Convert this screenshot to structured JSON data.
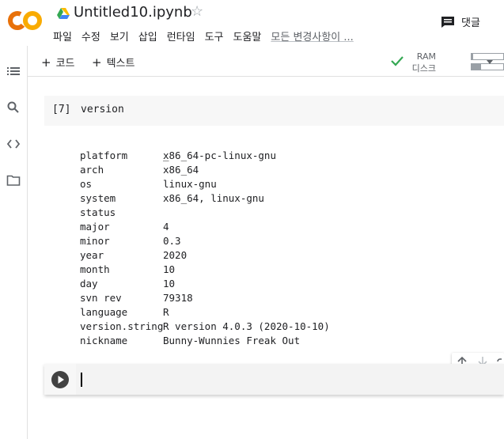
{
  "header": {
    "logo_text": "CO",
    "title": "Untitled10.ipynb",
    "menu": [
      "파일",
      "수정",
      "보기",
      "삽입",
      "런타임",
      "도구",
      "도움말"
    ],
    "changes_label": "모든 변경사항이 ...",
    "comment_label": "댓글"
  },
  "toolbar": {
    "add_code_label": "코드",
    "add_text_label": "텍스트",
    "ram_label": "RAM",
    "disk_label": "디스크",
    "ram_usage": 0.05,
    "disk_usage": 0.3
  },
  "cell": {
    "exec_count": "[7]",
    "code": "version"
  },
  "output": {
    "dash": "_",
    "rows": [
      {
        "key": "platform",
        "value": "x86_64-pc-linux-gnu"
      },
      {
        "key": "arch",
        "value": "x86_64"
      },
      {
        "key": "os",
        "value": "linux-gnu"
      },
      {
        "key": "system",
        "value": "x86_64, linux-gnu"
      },
      {
        "key": "status",
        "value": ""
      },
      {
        "key": "major",
        "value": "4"
      },
      {
        "key": "minor",
        "value": "0.3"
      },
      {
        "key": "year",
        "value": "2020"
      },
      {
        "key": "month",
        "value": "10"
      },
      {
        "key": "day",
        "value": "10"
      },
      {
        "key": "svn rev",
        "value": "79318"
      },
      {
        "key": "language",
        "value": "R"
      },
      {
        "key": "version.string",
        "value": "R version 4.0.3 (2020-10-10)"
      },
      {
        "key": "nickname",
        "value": "Bunny-Wunnies Freak Out"
      }
    ]
  },
  "colors": {
    "logo_orange": "#F9AB00",
    "logo_dark_orange": "#E8710A",
    "check_green": "#34A853"
  }
}
